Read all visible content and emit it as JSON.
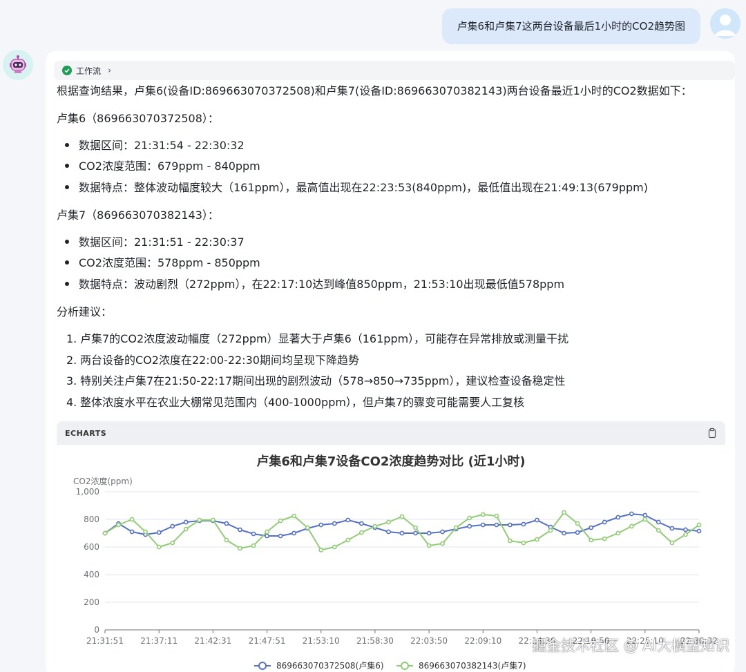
{
  "user_message": "卢集6和卢集7这两台设备最后1小时的CO2趋势图",
  "workflow": {
    "label": "工作流"
  },
  "answer": {
    "intro": "根据查询结果，卢集6(设备ID:869663070372508)和卢集7(设备ID:869663070382143)两台设备最近1小时的CO2数据如下：",
    "device6": {
      "heading": "卢集6（869663070372508）：",
      "bullets": [
        "数据区间：21:31:54 - 22:30:32",
        "CO2浓度范围：679ppm - 840ppm",
        "数据特点：整体波动幅度较大（161ppm），最高值出现在22:23:53(840ppm)，最低值出现在21:49:13(679ppm)"
      ]
    },
    "device7": {
      "heading": "卢集7（869663070382143）：",
      "bullets": [
        "数据区间：21:31:51 - 22:30:37",
        "CO2浓度范围：578ppm - 850ppm",
        "数据特点：波动剧烈（272ppm），在22:17:10达到峰值850ppm，21:53:10出现最低值578ppm"
      ]
    },
    "analysis_heading": "分析建议：",
    "analysis_items": [
      "卢集7的CO2浓度波动幅度（272ppm）显著大于卢集6（161ppm），可能存在异常排放或测量干扰",
      "两台设备的CO2浓度在22:00-22:30期间均呈现下降趋势",
      "特别关注卢集7在21:50-22:17期间出现的剧烈波动（578→850→735ppm），建议检查设备稳定性",
      "整体浓度水平在农业大棚常见范围内（400-1000ppm），但卢集7的骤变可能需要人工复核"
    ]
  },
  "echarts_label": "ECHARTS",
  "watermark": "掘金技术社区 @ AI大模型知识",
  "chart_data": {
    "type": "line",
    "title": "卢集6和卢集7设备CO2浓度趋势对比 (近1小时)",
    "ylabel": "CO2浓度(ppm)",
    "ylim": [
      0,
      1000
    ],
    "yticks": [
      "0",
      "200",
      "400",
      "600",
      "800",
      "1,000"
    ],
    "xticks": [
      "21:31:51",
      "21:37:11",
      "21:42:31",
      "21:47:51",
      "21:53:10",
      "21:58:30",
      "22:03:50",
      "22:09:10",
      "22:14:30",
      "22:19:50",
      "22:25:10",
      "22:30:32"
    ],
    "grid": "horizontal",
    "legend_position": "bottom",
    "series": [
      {
        "name": "869663070372508(卢集6)",
        "color": "#5470c6",
        "values": [
          700,
          770,
          710,
          690,
          705,
          750,
          780,
          790,
          790,
          770,
          725,
          695,
          680,
          680,
          700,
          735,
          760,
          770,
          795,
          770,
          740,
          710,
          700,
          700,
          700,
          710,
          730,
          750,
          760,
          760,
          760,
          765,
          795,
          745,
          700,
          705,
          740,
          780,
          815,
          840,
          830,
          780,
          735,
          725,
          715
        ]
      },
      {
        "name": "869663070382143(卢集7)",
        "color": "#91cc75",
        "values": [
          700,
          760,
          800,
          710,
          600,
          630,
          730,
          795,
          795,
          650,
          590,
          610,
          710,
          790,
          825,
          740,
          578,
          600,
          650,
          705,
          750,
          780,
          820,
          740,
          610,
          625,
          740,
          810,
          835,
          825,
          645,
          630,
          655,
          720,
          850,
          770,
          650,
          660,
          700,
          750,
          800,
          720,
          630,
          690,
          760
        ]
      }
    ]
  }
}
